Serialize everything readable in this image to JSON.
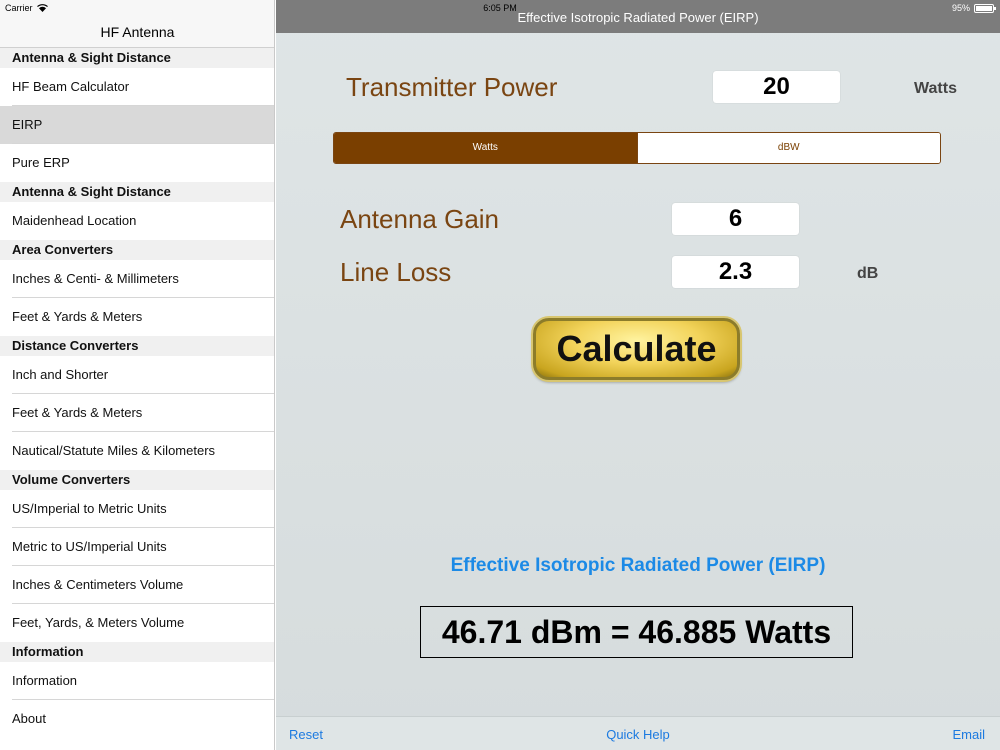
{
  "status_bar": {
    "carrier": "Carrier",
    "time": "6:05 PM",
    "battery": "95%",
    "wifi_icon": "wifi-icon",
    "battery_icon": "battery-icon"
  },
  "sidebar": {
    "title": "HF Antenna",
    "rows": [
      {
        "type": "section",
        "label": "Antenna & Sight Distance"
      },
      {
        "type": "item",
        "label": "HF Beam Calculator"
      },
      {
        "type": "item",
        "label": "EIRP",
        "selected": true
      },
      {
        "type": "item",
        "label": "Pure ERP"
      },
      {
        "type": "section",
        "label": "Antenna & Sight Distance"
      },
      {
        "type": "item",
        "label": "Maidenhead Location"
      },
      {
        "type": "section",
        "label": "Area Converters"
      },
      {
        "type": "item",
        "label": "Inches & Centi- & Millimeters"
      },
      {
        "type": "item",
        "label": "Feet & Yards & Meters"
      },
      {
        "type": "section",
        "label": "Distance Converters"
      },
      {
        "type": "item",
        "label": "Inch and Shorter"
      },
      {
        "type": "item",
        "label": "Feet & Yards & Meters"
      },
      {
        "type": "item",
        "label": "Nautical/Statute Miles & Kilometers"
      },
      {
        "type": "section",
        "label": "Volume Converters"
      },
      {
        "type": "item",
        "label": "US/Imperial to Metric Units"
      },
      {
        "type": "item",
        "label": "Metric to US/Imperial Units"
      },
      {
        "type": "item",
        "label": "Inches & Centimeters Volume"
      },
      {
        "type": "item",
        "label": "Feet, Yards, & Meters Volume"
      },
      {
        "type": "section",
        "label": "Information"
      },
      {
        "type": "item",
        "label": "Information"
      },
      {
        "type": "item",
        "label": "About"
      }
    ]
  },
  "main": {
    "title": "Effective Isotropic Radiated Power (EIRP)",
    "transmitter_power": {
      "label": "Transmitter Power",
      "value": "20",
      "unit": "Watts"
    },
    "power_unit_toggle": {
      "options": [
        "Watts",
        "dBW"
      ],
      "selected": "Watts"
    },
    "antenna_gain": {
      "label": "Antenna Gain",
      "value": "6"
    },
    "line_loss": {
      "label": "Line Loss",
      "value": "2.3",
      "unit": "dB"
    },
    "calculate_label": "Calculate",
    "result_heading": "Effective Isotropic Radiated Power (EIRP)",
    "result_value": "46.71 dBm = 46.885 Watts"
  },
  "bottom_bar": {
    "reset": "Reset",
    "quick_help": "Quick Help",
    "email": "Email"
  },
  "colors": {
    "accent_brown": "#7a3f00",
    "link_blue": "#1c7ae0",
    "result_blue": "#1c8ae6",
    "nav_gray": "#7c7c7c"
  }
}
